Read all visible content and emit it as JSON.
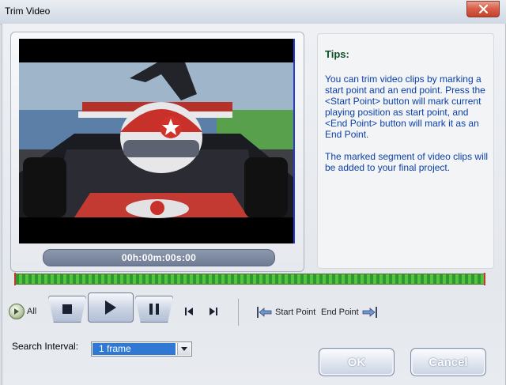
{
  "window": {
    "title": "Trim Video"
  },
  "video": {
    "timecode": "00h:00m:00s:00"
  },
  "tips": {
    "title": "Tips:",
    "paragraph1": "You can trim video clips by marking a start point and an end point. Press the <Start Point> button will mark current playing position as start point, and <End Point> button will mark it as an End Point.",
    "paragraph2": "The marked segment of video clips will be added to your final project."
  },
  "controls": {
    "all_label": "All",
    "start_point_label": "Start Point",
    "end_point_label": "End Point"
  },
  "search_interval": {
    "label": "Search Interval:",
    "value": "1 frame"
  },
  "buttons": {
    "ok": "OK",
    "cancel": "Cancel"
  },
  "colors": {
    "tips_title": "#0d4f25",
    "tips_body": "#0b3fa8",
    "timeline_green": "#2c9a2f",
    "accent_blue": "#2f78d4"
  },
  "icons": [
    "close-icon",
    "play-all-icon",
    "stop-icon",
    "play-icon",
    "pause-icon",
    "step-back-icon",
    "step-forward-icon",
    "start-point-icon",
    "end-point-icon",
    "dropdown-arrow-icon"
  ]
}
